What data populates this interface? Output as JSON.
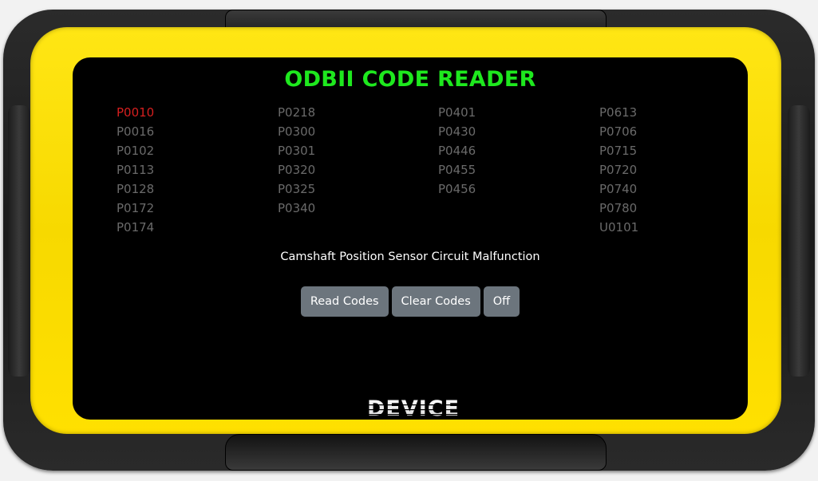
{
  "title": "ODBII CODE READER",
  "selected_code": "P0010",
  "columns": [
    [
      "P0010",
      "P0016",
      "P0102",
      "P0113",
      "P0128",
      "P0172",
      "P0174"
    ],
    [
      "P0218",
      "P0300",
      "P0301",
      "P0320",
      "P0325",
      "P0340"
    ],
    [
      "P0401",
      "P0430",
      "P0446",
      "P0455",
      "P0456"
    ],
    [
      "P0613",
      "P0706",
      "P0715",
      "P0720",
      "P0740",
      "P0780",
      "U0101"
    ]
  ],
  "description": "Camshaft Position Sensor Circuit Malfunction",
  "buttons": {
    "read": "Read Codes",
    "clear": "Clear Codes",
    "off": "Off"
  },
  "logo": "DEVICE",
  "colors": {
    "title": "#1ee81e",
    "selected_code": "#d61f1f",
    "code": "#6a6a6a",
    "button": "#6c757d",
    "frame": "#ffe000"
  }
}
